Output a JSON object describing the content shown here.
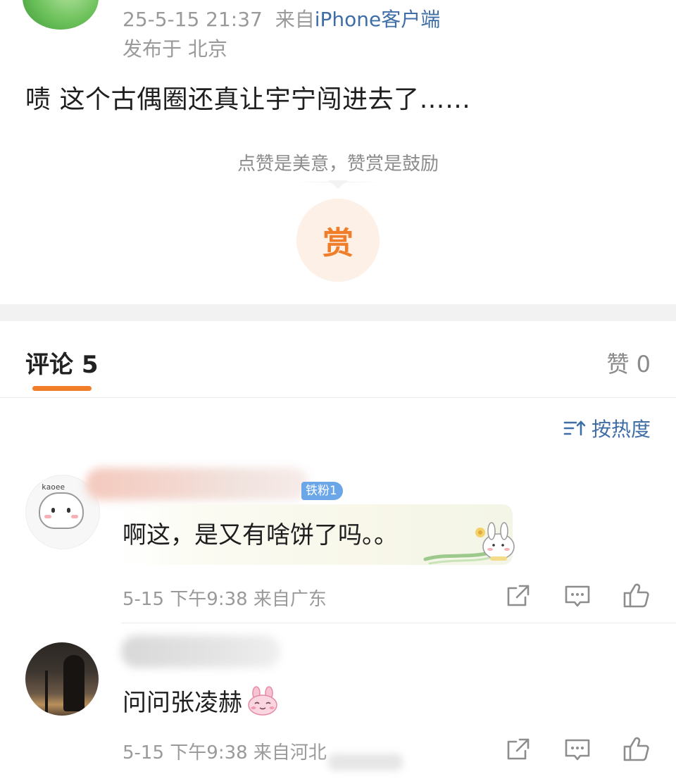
{
  "post": {
    "timestamp": "25-5-15 21:37",
    "source_prefix": "来自",
    "source": "iPhone客户端",
    "location": "发布于 北京",
    "text": "啧 这个古偶圈还真让宇宁闯进去了……"
  },
  "reward": {
    "hint": "点赞是美意，赞赏是鼓励",
    "button_label": "赏",
    "accent": "#f07d2a"
  },
  "tabs": {
    "comments_label": "评论 5",
    "likes_label": "赞 0"
  },
  "sort": {
    "label": "按热度",
    "icon": "sort-icon",
    "color": "#3f6ea7"
  },
  "comments": [
    {
      "badge": "铁粉1",
      "text": "啊这，是又有啥饼了吗。。",
      "meta": "5-15 下午9:38 来自广东"
    },
    {
      "text": "问问张凌赫",
      "emoji": "bunny-smile-emoji",
      "meta": "5-15 下午9:38 来自河北"
    }
  ]
}
